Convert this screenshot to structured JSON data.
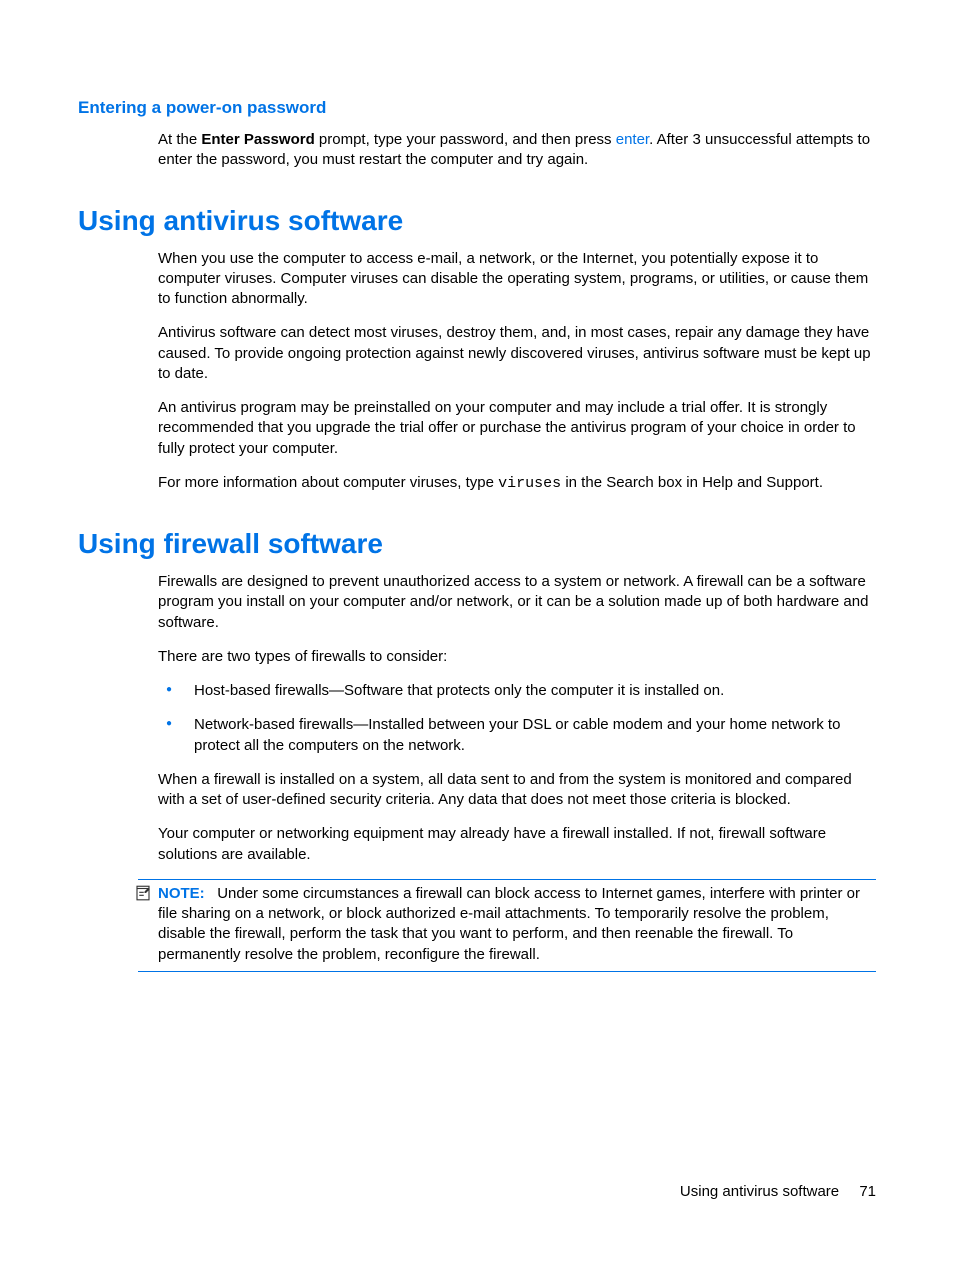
{
  "section1": {
    "heading": "Entering a power-on password",
    "para1a": "At the ",
    "para1b": "Enter Password",
    "para1c": " prompt, type your password, and then press ",
    "para1d": "enter",
    "para1e": ". After 3 unsuccessful attempts to enter the password, you must restart the computer and try again."
  },
  "section2": {
    "heading": "Using antivirus software",
    "p1": "When you use the computer to access e-mail, a network, or the Internet, you potentially expose it to computer viruses. Computer viruses can disable the operating system, programs, or utilities, or cause them to function abnormally.",
    "p2": "Antivirus software can detect most viruses, destroy them, and, in most cases, repair any damage they have caused. To provide ongoing protection against newly discovered viruses, antivirus software must be kept up to date.",
    "p3": "An antivirus program may be preinstalled on your computer and may include a trial offer. It is strongly recommended that you upgrade the trial offer or purchase the antivirus program of your choice in order to fully protect your computer.",
    "p4a": "For more information about computer viruses, type ",
    "p4b": "viruses",
    "p4c": " in the Search box in Help and Support."
  },
  "section3": {
    "heading": "Using firewall software",
    "p1": "Firewalls are designed to prevent unauthorized access to a system or network. A firewall can be a software program you install on your computer and/or network, or it can be a solution made up of both hardware and software.",
    "p2": "There are two types of firewalls to consider:",
    "bullet1": "Host-based firewalls—Software that protects only the computer it is installed on.",
    "bullet2": "Network-based firewalls—Installed between your DSL or cable modem and your home network to protect all the computers on the network.",
    "p3": "When a firewall is installed on a system, all data sent to and from the system is monitored and compared with a set of user-defined security criteria. Any data that does not meet those criteria is blocked.",
    "p4": "Your computer or networking equipment may already have a firewall installed. If not, firewall software solutions are available.",
    "note_label": "NOTE:",
    "note_text": "Under some circumstances a firewall can block access to Internet games, interfere with printer or file sharing on a network, or block authorized e-mail attachments. To temporarily resolve the problem, disable the firewall, perform the task that you want to perform, and then reenable the firewall. To permanently resolve the problem, reconfigure the firewall."
  },
  "footer": {
    "title": "Using antivirus software",
    "page": "71"
  }
}
